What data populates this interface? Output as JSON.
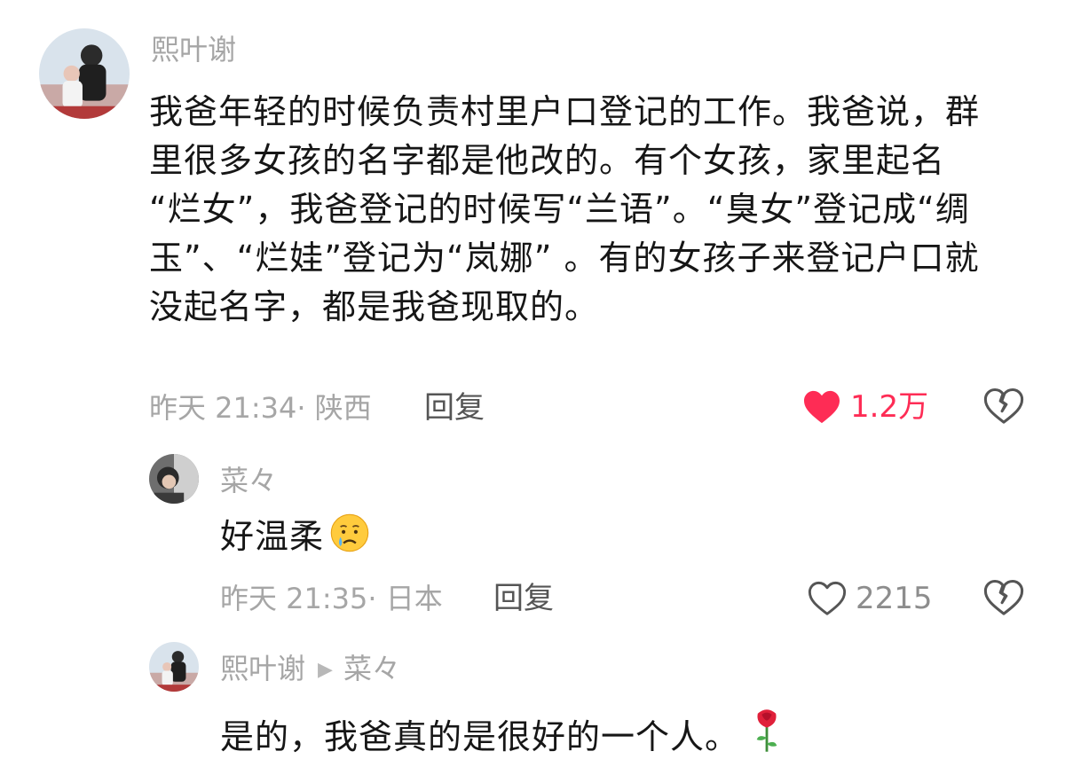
{
  "comments": [
    {
      "username": "熙叶谢",
      "lines": [
        "我爸年轻的时候负责村里户口登记的工作。我爸说，群",
        "里很多女孩的名字都是他改的。有个女孩，家里起名",
        "“烂女”，我爸登记的时候写“兰语”。“臭女”登记成“绸",
        "玉”、“烂娃”登记为“岚娜” 。有的女孩子来登记户口就",
        "没起名字，都是我爸现取的。"
      ],
      "meta": "昨天 21:34· 陕西",
      "reply_label": "回复",
      "like_count": "1.2万",
      "liked": true
    },
    {
      "username": "菜々",
      "text": "好温柔",
      "emoji": "crying-face-emoji",
      "meta": "昨天 21:35· 日本",
      "reply_label": "回复",
      "like_count": "2215",
      "liked": false
    },
    {
      "username": "熙叶谢",
      "reply_to": "菜々",
      "text": "是的，我爸真的是很好的一个人。",
      "emoji": "rose-emoji"
    }
  ],
  "colors": {
    "like_active": "#fe2c55",
    "meta_gray": "#a6a6a6",
    "text": "#161616"
  }
}
